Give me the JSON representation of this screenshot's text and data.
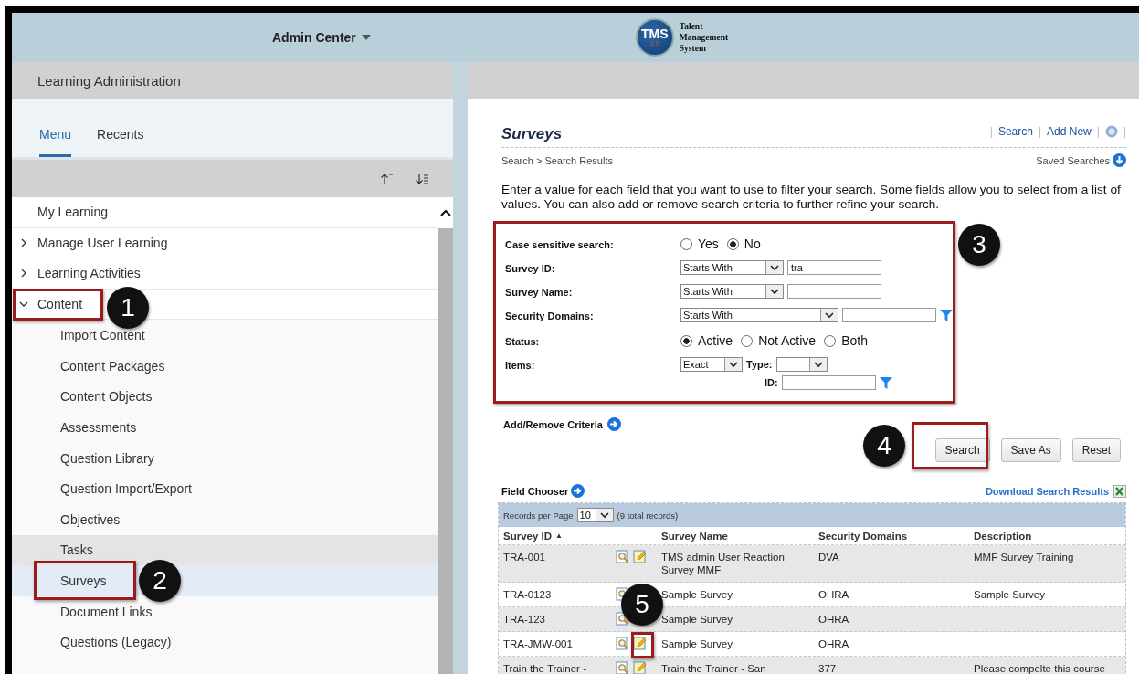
{
  "header": {
    "title": "Admin Center",
    "logo": {
      "badge": "TMS",
      "version": "2.0",
      "lines": [
        "Talent",
        "Management",
        "System"
      ]
    }
  },
  "sidebar": {
    "title": "Learning Administration",
    "tabs": [
      {
        "label": "Menu",
        "selected": true
      },
      {
        "label": "Recents",
        "selected": false
      }
    ],
    "items": [
      {
        "label": "My Learning",
        "kind": "leaf"
      },
      {
        "label": "Manage User Learning",
        "kind": "group",
        "expanded": false
      },
      {
        "label": "Learning Activities",
        "kind": "group",
        "expanded": false
      },
      {
        "label": "Content",
        "kind": "group",
        "expanded": true,
        "children": [
          {
            "label": "Import Content",
            "selected": false,
            "hovered": false
          },
          {
            "label": "Content Packages",
            "selected": false,
            "hovered": false
          },
          {
            "label": "Content Objects",
            "selected": false,
            "hovered": false
          },
          {
            "label": "Assessments",
            "selected": false,
            "hovered": false
          },
          {
            "label": "Question Library",
            "selected": false,
            "hovered": false
          },
          {
            "label": "Question Import/Export",
            "selected": false,
            "hovered": false
          },
          {
            "label": "Objectives",
            "selected": false,
            "hovered": false
          },
          {
            "label": "Tasks",
            "selected": false,
            "hovered": true
          },
          {
            "label": "Surveys",
            "selected": true,
            "hovered": false
          },
          {
            "label": "Document Links",
            "selected": false,
            "hovered": false
          },
          {
            "label": "Questions (Legacy)",
            "selected": false,
            "hovered": false
          }
        ]
      }
    ]
  },
  "main": {
    "title": "Surveys",
    "separator": "|",
    "links": [
      "Search",
      "Add New"
    ],
    "breadcrumb": "Search > Search Results",
    "saved_searches": "Saved Searches",
    "intro": "Enter a value for each field that you want to use to filter your search. Some fields allow you to select from a list of values. You can also add or remove search criteria to further refine your search.",
    "form": [
      {
        "kind": "radio",
        "label": "Case sensitive search:",
        "options": [
          {
            "label": "Yes",
            "selected": false
          },
          {
            "label": "No",
            "selected": true
          }
        ]
      },
      {
        "kind": "match",
        "label": "Survey ID:",
        "operator": "Starts With",
        "value": "tra"
      },
      {
        "kind": "match",
        "label": "Survey Name:",
        "operator": "Starts With"
      },
      {
        "kind": "match_wide",
        "label": "Security Domains:",
        "operator": "Starts With"
      },
      {
        "kind": "radio",
        "label": "Status:",
        "options": [
          {
            "label": "Active",
            "selected": true
          },
          {
            "label": "Not Active",
            "selected": false
          },
          {
            "label": "Both",
            "selected": false
          }
        ]
      },
      {
        "kind": "items",
        "label": "Items:",
        "operator": "Exact",
        "type_label": "Type:",
        "id_label": "ID:"
      }
    ],
    "add_remove": "Add/Remove Criteria",
    "buttons": [
      "Search",
      "Save As",
      "Reset"
    ],
    "field_chooser": "Field Chooser",
    "download": "Download Search Results",
    "table": {
      "records_label": "Records per Page",
      "page_size": "10",
      "total": "(9 total records)",
      "columns": [
        {
          "label": "Survey ID",
          "sort_indicator": "▲"
        },
        {
          "label": "Survey Name"
        },
        {
          "label": "Security Domains"
        },
        {
          "label": "Description"
        }
      ],
      "rows": [
        {
          "id": "TRA-001",
          "name": "TMS admin User Reaction Survey MMF",
          "domains": "DVA",
          "description": "MMF Survey Training",
          "edit_visible": true
        },
        {
          "id": "TRA-0123",
          "name": "Sample Survey",
          "domains": "OHRA",
          "description": "Sample Survey",
          "edit_visible": false
        },
        {
          "id": "TRA-123",
          "name": "Sample Survey",
          "domains": "OHRA",
          "edit_visible": false
        },
        {
          "id": "TRA-JMW-001",
          "name": "Sample Survey",
          "domains": "OHRA",
          "edit_visible": true
        },
        {
          "id": "Train the Trainer -",
          "name": "Train the Trainer - San",
          "domains": "377",
          "description": "Please compelte this course",
          "edit_visible": true
        }
      ]
    }
  },
  "annotations": [
    {
      "number": "1"
    },
    {
      "number": "2"
    },
    {
      "number": "3"
    },
    {
      "number": "4"
    },
    {
      "number": "5"
    }
  ]
}
